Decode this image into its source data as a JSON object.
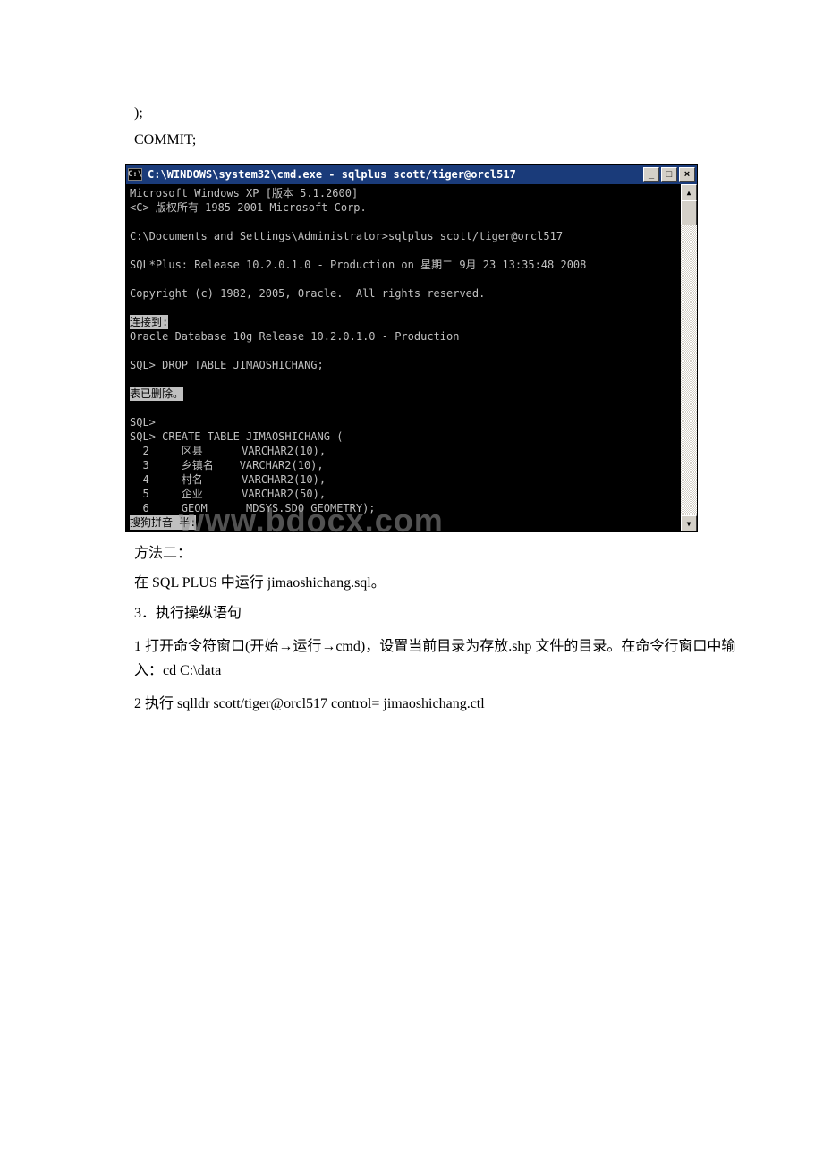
{
  "doc": {
    "line1": " );",
    "line2": "COMMIT;",
    "method2": "方法二：",
    "sqlplus_run": "在 SQL PLUS 中运行 jimaoshichang.sql。",
    "step3": "3．执行操纵语句",
    "step3_1": "1 打开命令符窗口(开始→运行→cmd)，设置当前目录为存放.shp 文件的目录。在命令行窗口中输入：cd C:\\data",
    "step3_2": "2 执行 sqlldr scott/tiger@orcl517 control= jimaoshichang.ctl"
  },
  "cmd": {
    "icon": "C:\\",
    "title": "C:\\WINDOWS\\system32\\cmd.exe - sqlplus scott/tiger@orcl517",
    "minimize": "_",
    "maximize": "□",
    "close": "×",
    "scroll_up": "▲",
    "scroll_down": "▼",
    "body_top": "Microsoft Windows XP [版本 5.1.2600]\n<C> 版权所有 1985-2001 Microsoft Corp.\n\nC:\\Documents and Settings\\Administrator>sqlplus scott/tiger@orcl517\n\nSQL*Plus: Release 10.2.0.1.0 - Production on 星期二 9月 23 13:35:48 2008\n\nCopyright (c) 1982, 2005, Oracle.  All rights reserved.\n\n",
    "connected": "连接到:",
    "body_mid": "\nOracle Database 10g Release 10.2.0.1.0 - Production\n\nSQL> DROP TABLE JIMAOSHICHANG;\n\n",
    "table_dropped": "表已删除。",
    "body_bot": "\n\nSQL>\nSQL> CREATE TABLE JIMAOSHICHANG (\n  2     区县      VARCHAR2(10),\n  3     乡镇名    VARCHAR2(10),\n  4     村名      VARCHAR2(10),\n  5     企业      VARCHAR2(50),\n  6     GEOM      MDSYS.SDO_GEOMETRY);\n",
    "ime": "搜狗拼音 半:"
  },
  "watermark": "www.bdocx.com"
}
